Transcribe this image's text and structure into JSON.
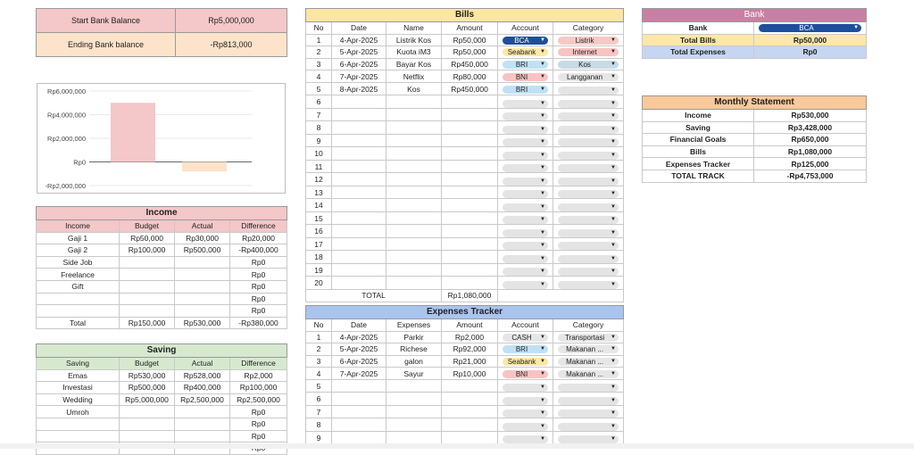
{
  "summary": {
    "start_label": "Start Bank Balance",
    "start_value": "Rp5,000,000",
    "end_label": "Ending Bank balance",
    "end_value": "-Rp813,000"
  },
  "chart_data": {
    "type": "bar",
    "categories": [
      "Start Bank Balance",
      "Ending Bank balance"
    ],
    "values": [
      5000000,
      -813000
    ],
    "colors": [
      "#f4c7c8",
      "#fde3c9"
    ],
    "ylim": [
      -2000000,
      6000000
    ],
    "yticks": [
      "Rp6,000,000",
      "Rp4,000,000",
      "Rp2,000,000",
      "Rp0",
      "-Rp2,000,000"
    ],
    "ytick_values": [
      6000000,
      4000000,
      2000000,
      0,
      -2000000
    ],
    "grid": true
  },
  "income": {
    "title": "Income",
    "headers": [
      "Income",
      "Budget",
      "Actual",
      "Difference"
    ],
    "rows": [
      [
        "Gaji 1",
        "Rp50,000",
        "Rp30,000",
        "Rp20,000"
      ],
      [
        "Gaji 2",
        "Rp100,000",
        "Rp500,000",
        "-Rp400,000"
      ],
      [
        "Side Job",
        "",
        "",
        "Rp0"
      ],
      [
        "Freelance",
        "",
        "",
        "Rp0"
      ],
      [
        "Gift",
        "",
        "",
        "Rp0"
      ],
      [
        "",
        "",
        "",
        "Rp0"
      ],
      [
        "",
        "",
        "",
        "Rp0"
      ]
    ],
    "total": [
      "Total",
      "Rp150,000",
      "Rp530,000",
      "-Rp380,000"
    ]
  },
  "saving": {
    "title": "Saving",
    "headers": [
      "Saving",
      "Budget",
      "Actual",
      "Difference"
    ],
    "rows": [
      [
        "Emas",
        "Rp530,000",
        "Rp528,000",
        "Rp2,000"
      ],
      [
        "Investasi",
        "Rp500,000",
        "Rp400,000",
        "Rp100,000"
      ],
      [
        "Wedding",
        "Rp5,000,000",
        "Rp2,500,000",
        "Rp2,500,000"
      ],
      [
        "Umroh",
        "",
        "",
        "Rp0"
      ],
      [
        "",
        "",
        "",
        "Rp0"
      ],
      [
        "",
        "",
        "",
        "Rp0"
      ],
      [
        "",
        "",
        "",
        "Rp0"
      ]
    ]
  },
  "bills": {
    "title": "Bills",
    "headers": [
      "No",
      "Date",
      "Name",
      "Amount",
      "Account",
      "Category"
    ],
    "rows": [
      {
        "no": "1",
        "date": "4-Apr-2025",
        "name": "Listrik Kos",
        "amount": "Rp50,000",
        "account": "BCA",
        "category": "Listrik"
      },
      {
        "no": "2",
        "date": "5-Apr-2025",
        "name": "Kuota iM3",
        "amount": "Rp50,000",
        "account": "Seabank",
        "category": "Internet"
      },
      {
        "no": "3",
        "date": "6-Apr-2025",
        "name": "Bayar Kos",
        "amount": "Rp450,000",
        "account": "BRI",
        "category": "Kos"
      },
      {
        "no": "4",
        "date": "7-Apr-2025",
        "name": "Netflix",
        "amount": "Rp80,000",
        "account": "BNI",
        "category": "Langganan"
      },
      {
        "no": "5",
        "date": "8-Apr-2025",
        "name": "Kos",
        "amount": "Rp450,000",
        "account": "BRI",
        "category": ""
      },
      {
        "no": "6"
      },
      {
        "no": "7"
      },
      {
        "no": "8"
      },
      {
        "no": "9"
      },
      {
        "no": "10"
      },
      {
        "no": "11"
      },
      {
        "no": "12"
      },
      {
        "no": "13"
      },
      {
        "no": "14"
      },
      {
        "no": "15"
      },
      {
        "no": "16"
      },
      {
        "no": "17"
      },
      {
        "no": "18"
      },
      {
        "no": "19"
      },
      {
        "no": "20"
      }
    ],
    "total_label": "TOTAL",
    "total_value": "Rp1,080,000"
  },
  "expenses": {
    "title": "Expenses Tracker",
    "headers": [
      "No",
      "Date",
      "Expenses",
      "Amount",
      "Account",
      "Category"
    ],
    "rows": [
      {
        "no": "1",
        "date": "4-Apr-2025",
        "name": "Parkir",
        "amount": "Rp2,000",
        "account": "CASH",
        "category": "Transportasi"
      },
      {
        "no": "2",
        "date": "5-Apr-2025",
        "name": "Richese",
        "amount": "Rp92,000",
        "account": "BRI",
        "category": "Makanan ..."
      },
      {
        "no": "3",
        "date": "6-Apr-2025",
        "name": "galon",
        "amount": "Rp21,000",
        "account": "Seabank",
        "category": "Makanan ..."
      },
      {
        "no": "4",
        "date": "7-Apr-2025",
        "name": "Sayur",
        "amount": "Rp10,000",
        "account": "BNI",
        "category": "Makanan ..."
      },
      {
        "no": "5"
      },
      {
        "no": "6"
      },
      {
        "no": "7"
      },
      {
        "no": "8"
      },
      {
        "no": "9"
      }
    ]
  },
  "bank": {
    "title": "Bank",
    "bank_label": "Bank",
    "bank_value": "BCA",
    "total_bills_label": "Total Bills",
    "total_bills_value": "Rp50,000",
    "total_expenses_label": "Total Expenses",
    "total_expenses_value": "Rp0"
  },
  "monthly": {
    "title": "Monthly Statement",
    "rows": [
      [
        "Income",
        "Rp530,000"
      ],
      [
        "Saving",
        "Rp3,428,000"
      ],
      [
        "Financial Goals",
        "Rp650,000"
      ],
      [
        "Bills",
        "Rp1,080,000"
      ],
      [
        "Expenses Tracker",
        "Rp125,000"
      ],
      [
        "TOTAL TRACK",
        "-Rp4,753,000"
      ]
    ]
  },
  "colors": {
    "BCA": "#1f4e9c",
    "Seabank": "#fde8a6",
    "BRI": "#bfe1f6",
    "BNI": "#f8c3c3",
    "CASH": "#e6e6e6",
    "Listrik": "#f8c9c4",
    "Internet": "#f8c3c3",
    "Kos": "#c7dbe6",
    "Langganan": "#e6e6e6",
    "Transportasi": "#e6e6e6",
    "Makanan ...": "#e6e6e6",
    "bills_header": "#fbe6a2",
    "expenses_header": "#a9c4ef",
    "income_header": "#f4c7c8",
    "saving_header": "#d6e9cf",
    "bank_header": "#c97fa3",
    "monthly_header": "#f7c99b"
  },
  "icons": {
    "dropdown": "triangle-down-icon"
  }
}
